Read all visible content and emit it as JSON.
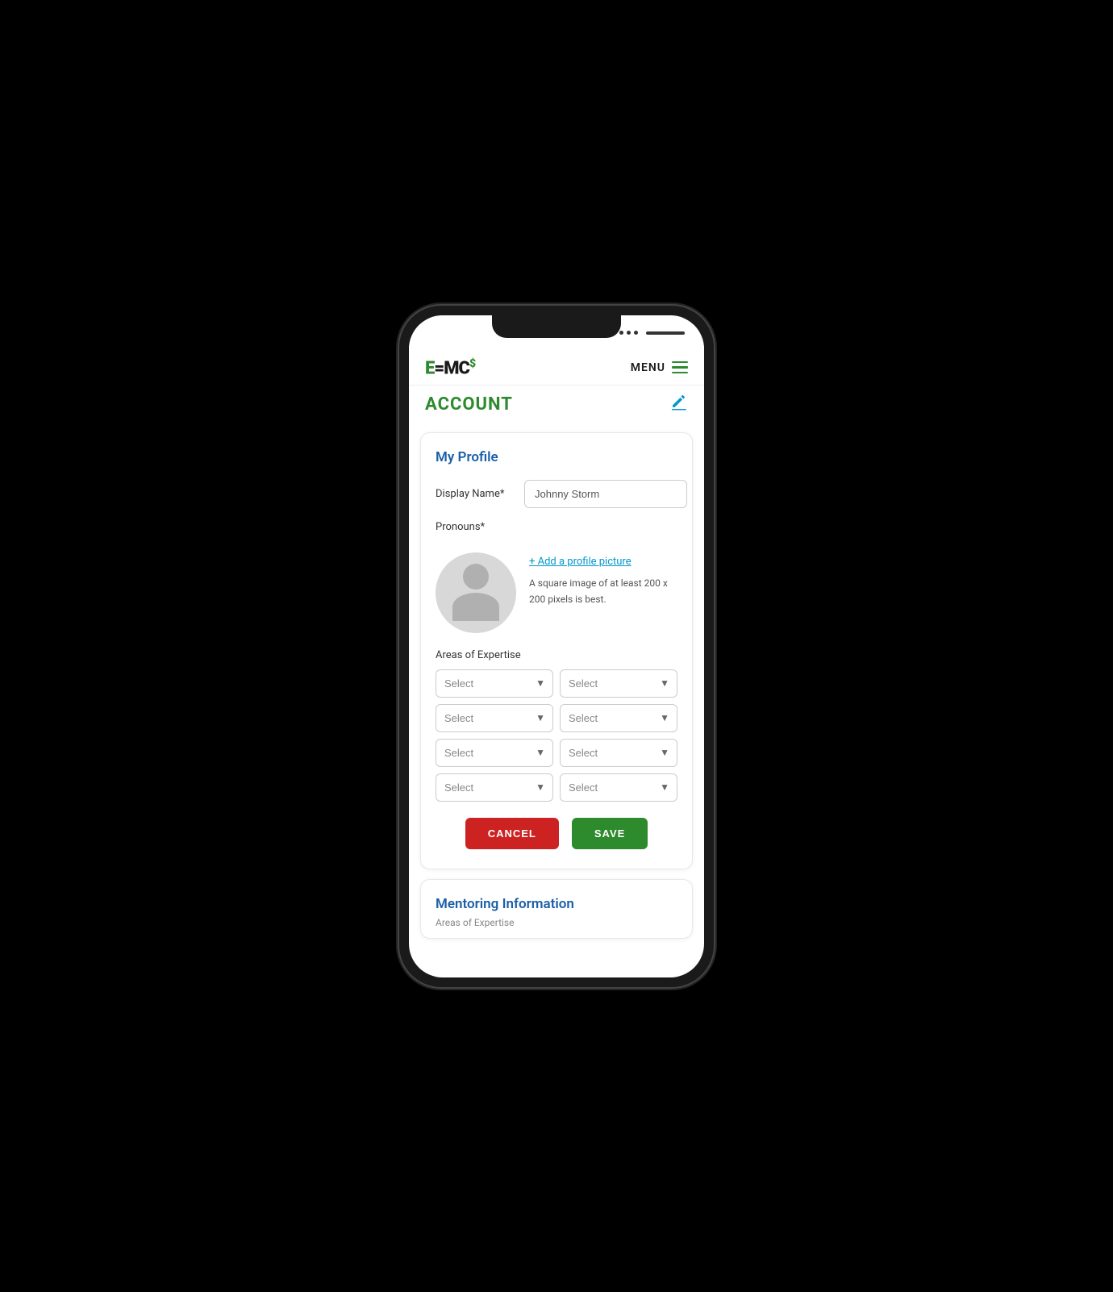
{
  "status_bar": {
    "dots": 4,
    "label": "signal"
  },
  "nav": {
    "logo_e": "E",
    "logo_equals": "=",
    "logo_mc": "MC",
    "logo_dollar": "$",
    "menu_label": "MENU"
  },
  "page": {
    "title": "ACCOUNT"
  },
  "profile_card": {
    "title": "My Profile",
    "display_name_label": "Display Name*",
    "display_name_value": "Johnny Storm",
    "pronouns_label": "Pronouns*",
    "add_pic_link": "+ Add a profile picture",
    "pic_hint": "A square image of at least 200 x 200 pixels is best.",
    "expertise_label": "Areas of Expertise",
    "selects": [
      {
        "id": "s1",
        "placeholder": "Select"
      },
      {
        "id": "s2",
        "placeholder": "Select"
      },
      {
        "id": "s3",
        "placeholder": "Select"
      },
      {
        "id": "s4",
        "placeholder": "Select"
      },
      {
        "id": "s5",
        "placeholder": "Select"
      },
      {
        "id": "s6",
        "placeholder": "Select"
      },
      {
        "id": "s7",
        "placeholder": "Select"
      },
      {
        "id": "s8",
        "placeholder": "Select"
      }
    ],
    "cancel_label": "CANCEL",
    "save_label": "SAVE"
  },
  "mentoring_card": {
    "title": "Mentoring Information",
    "subtitle": "Areas of Expertise"
  }
}
